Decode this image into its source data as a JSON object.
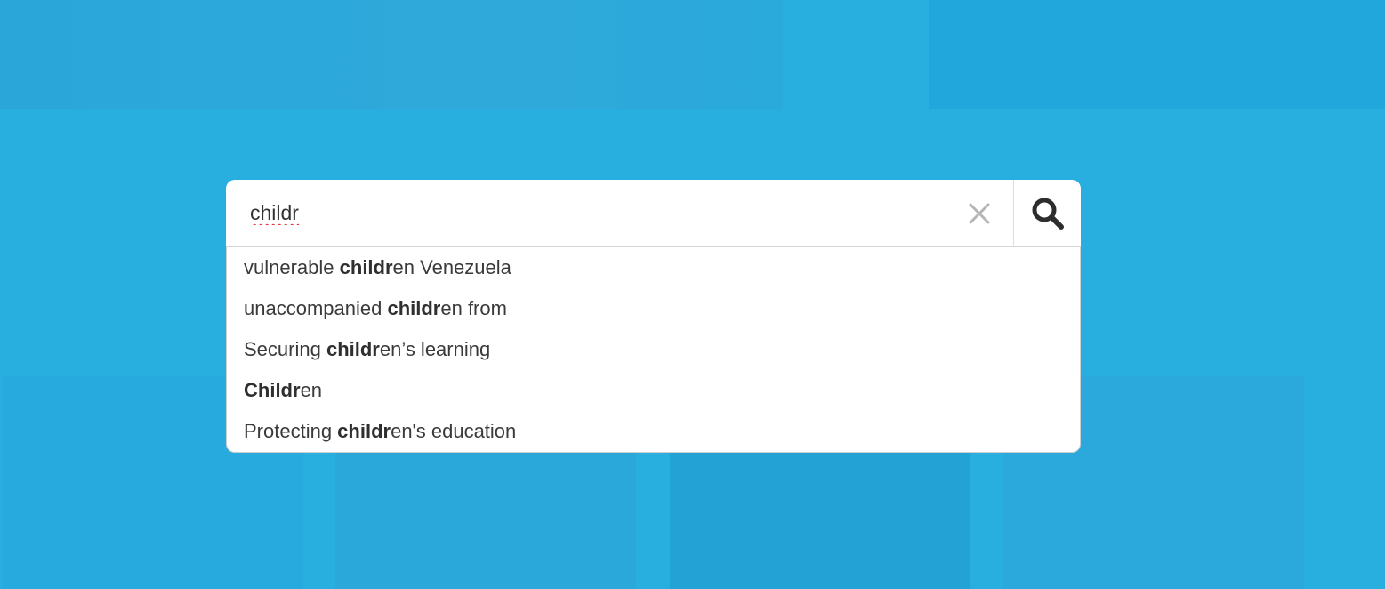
{
  "search": {
    "value": "childr",
    "clear_icon": "close-icon",
    "search_icon": "search-icon"
  },
  "suggestions": [
    {
      "before": "vulnerable ",
      "match": "childr",
      "after": "en Venezuela"
    },
    {
      "before": "unaccompanied ",
      "match": "childr",
      "after": "en from"
    },
    {
      "before": "Securing ",
      "match": "childr",
      "after": "en’s learning"
    },
    {
      "before": "",
      "match": "Childr",
      "after": "en"
    },
    {
      "before": "Protecting ",
      "match": "childr",
      "after": "en's education"
    }
  ],
  "colors": {
    "background": "#29aee0",
    "panel": "#ffffff",
    "text": "#3a3a3a"
  }
}
